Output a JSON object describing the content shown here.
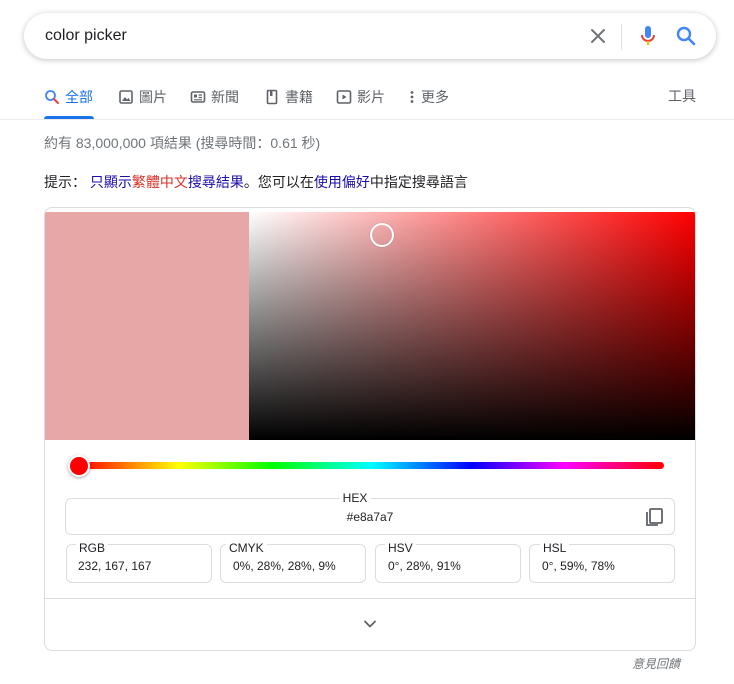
{
  "search": {
    "query": "color picker"
  },
  "tabs": [
    {
      "label": "全部",
      "icon": "search-icon",
      "active": true
    },
    {
      "label": "圖片",
      "icon": "image-icon"
    },
    {
      "label": "新聞",
      "icon": "news-icon"
    },
    {
      "label": "書籍",
      "icon": "book-icon"
    },
    {
      "label": "影片",
      "icon": "video-icon"
    },
    {
      "label": "更多",
      "icon": "more-vert-icon"
    }
  ],
  "tools_label": "工具",
  "result_stats": "約有 83,000,000 項結果 (搜尋時間：0.61 秒)",
  "hint": {
    "prefix": "提示：",
    "link1": "只顯示",
    "link1_red": "繁體中文",
    "link1_tail": "搜尋結果",
    "middle": "。您可以在",
    "link2": "使用偏好",
    "suffix": "中指定搜尋語言"
  },
  "color_picker": {
    "selected_color": "#e8a7a7",
    "hue_color": "#ff0000",
    "hex_label": "HEX",
    "hex_value": "#e8a7a7",
    "fields": [
      {
        "label": "RGB",
        "value": "232, 167, 167"
      },
      {
        "label": "CMYK",
        "value": "0%, 28%, 28%, 9%"
      },
      {
        "label": "HSV",
        "value": "0°, 28%, 91%"
      },
      {
        "label": "HSL",
        "value": "0°, 59%, 78%"
      }
    ]
  },
  "feedback_label": "意見回饋",
  "colors": {
    "accent": "#1a73e8",
    "link": "#1a0dab",
    "highlight": "#d93025"
  }
}
